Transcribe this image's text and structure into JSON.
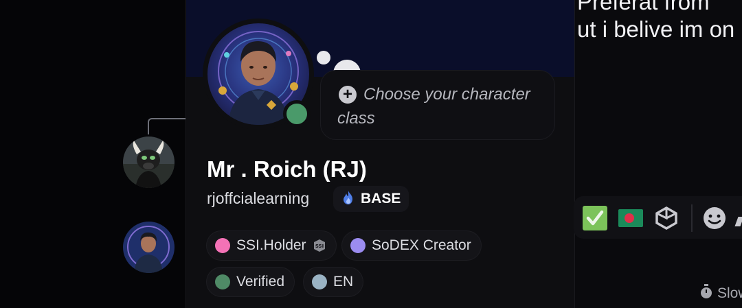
{
  "chat": {
    "line1": "Preferat from",
    "line2": "ut i belive im on"
  },
  "profile": {
    "display_name": "Mr . Roich (RJ)",
    "username": "rjoffcialearning",
    "tag_label": "BASE",
    "status_prompt": "Choose your character class",
    "online_color": "#4a9a6a"
  },
  "roles": [
    {
      "name": "SSI.Holder",
      "color": "#f472b6",
      "badge": "ssi-icon"
    },
    {
      "name": "SoDEX Creator",
      "color": "#9b8cf0"
    },
    {
      "name": "Verified",
      "color": "#4f8a66"
    },
    {
      "name": "EN",
      "color": "#9ab3c4"
    }
  ],
  "reactions": [
    "checkmark-emoji",
    "flag-emoji",
    "cube-emoji",
    "add-reaction-icon"
  ],
  "footer": {
    "slowmode": "Slow"
  }
}
